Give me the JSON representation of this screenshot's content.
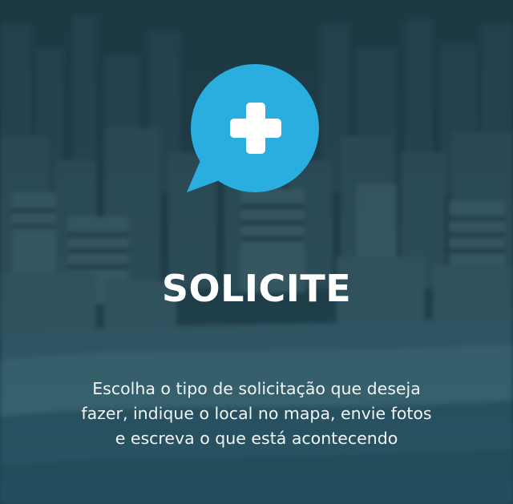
{
  "background": {
    "description_icon": "city-skyline-photo",
    "tint_color": "#1c3a45"
  },
  "icon": {
    "name": "plus-chat-bubble-icon",
    "bubble_color": "#2aaee0",
    "plus_color": "#ffffff"
  },
  "title": "SOLICITE",
  "description": {
    "line1": "Escolha o tipo de solicitação que deseja",
    "line2": "fazer, indique o local no mapa, envie fotos",
    "line3": "e escreva o que está acontecendo"
  }
}
